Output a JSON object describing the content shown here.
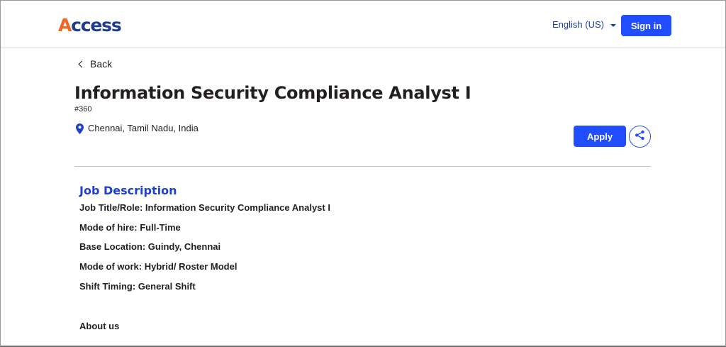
{
  "header": {
    "logo_text_a": "A",
    "logo_text_rest": "ccess",
    "language": "English (US)",
    "sign_in": "Sign in"
  },
  "nav": {
    "back": "Back"
  },
  "job": {
    "title": "Information Security Compliance Analyst I",
    "id": "#360",
    "location": "Chennai, Tamil Nadu, India",
    "apply": "Apply"
  },
  "description": {
    "heading": "Job Description",
    "lines": [
      "Job Title/Role: Information Security Compliance Analyst I",
      "Mode of hire: Full-Time",
      "Base Location: Guindy, Chennai",
      "Mode of work: Hybrid/ Roster Model",
      "Shift Timing: General Shift"
    ],
    "about_heading": "About us"
  },
  "colors": {
    "accent": "#1f4dff",
    "logo_orange": "#f26522",
    "logo_navy": "#1f3d8a",
    "heading_blue": "#1f3fd1"
  },
  "icons": {
    "location": "map-pin-icon",
    "share": "share-icon",
    "back": "chevron-left-icon",
    "language": "caret-down-icon"
  }
}
